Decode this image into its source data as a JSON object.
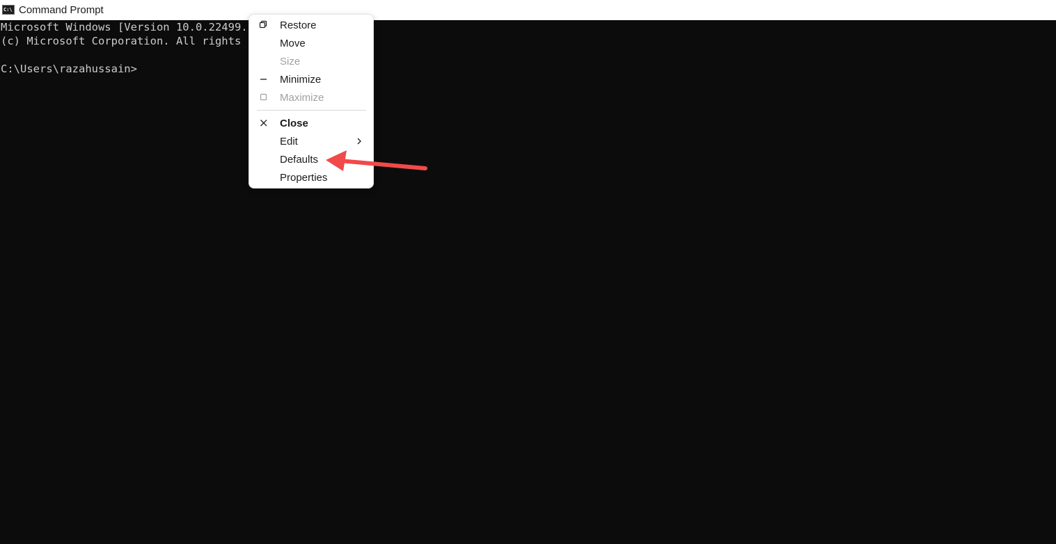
{
  "window": {
    "title": "Command Prompt",
    "icon": "cmd-app-icon",
    "icon_text": "C:\\"
  },
  "console": {
    "lines": [
      "Microsoft Windows [Version 10.0.22499.10",
      "(c) Microsoft Corporation. All rights re",
      "",
      "C:\\Users\\razahussain>"
    ],
    "text_color": "#cccccc",
    "background": "#0c0c0c"
  },
  "system_menu": {
    "items": [
      {
        "label": "Restore",
        "icon": "restore-icon",
        "enabled": true
      },
      {
        "label": "Move",
        "enabled": true
      },
      {
        "label": "Size",
        "enabled": false
      },
      {
        "label": "Minimize",
        "icon": "minimize-icon",
        "enabled": true
      },
      {
        "label": "Maximize",
        "icon": "maximize-icon",
        "enabled": false
      },
      {
        "label": "Close",
        "icon": "close-icon",
        "enabled": true,
        "bold": true
      },
      {
        "label": "Edit",
        "has_submenu": true,
        "enabled": true
      },
      {
        "label": "Defaults",
        "enabled": true
      },
      {
        "label": "Properties",
        "enabled": true
      }
    ]
  },
  "annotation": {
    "type": "arrow",
    "points_to": "Defaults",
    "color": "#f04a4a"
  }
}
